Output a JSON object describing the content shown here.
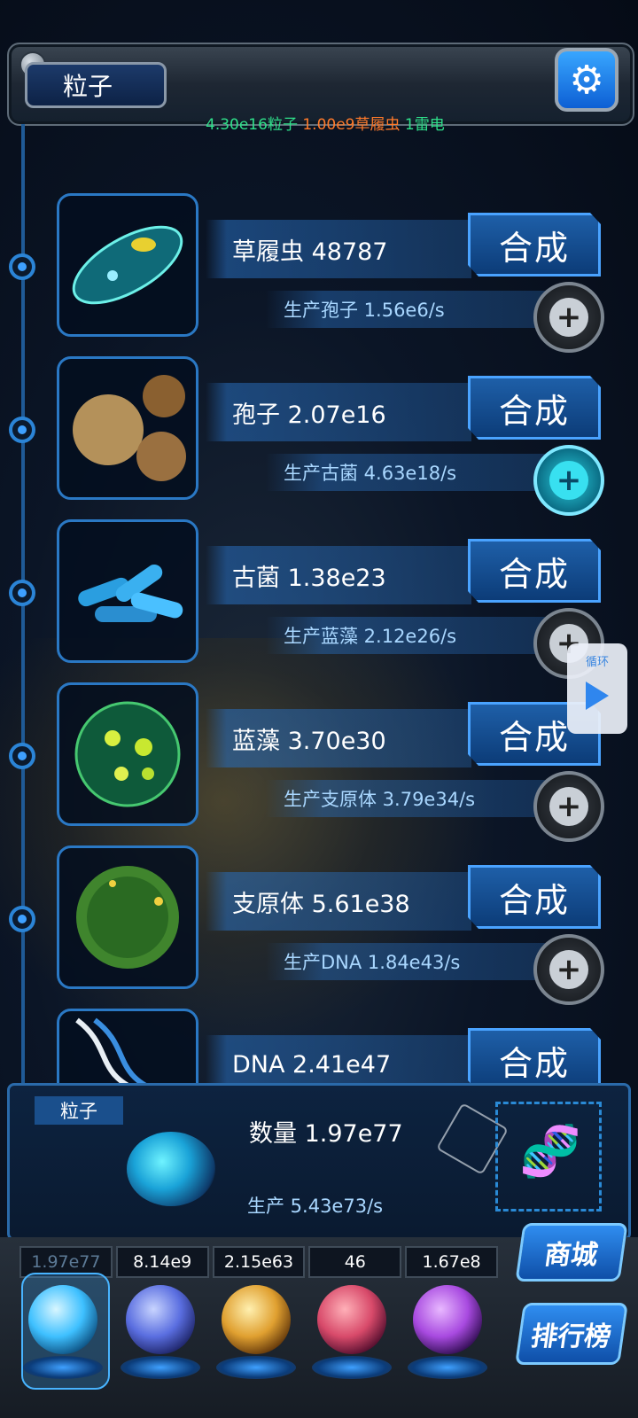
{
  "header": {
    "title": "粒子",
    "settings_icon": "gear-icon",
    "resources": {
      "particles": "4.30e16粒子",
      "paramecium": "1.00e9草履虫",
      "thunder": "1雷电"
    }
  },
  "rows": [
    {
      "name_count": "草履虫 48787",
      "production": "生产孢子 1.56e6/s",
      "merge_label": "合成",
      "thumb_icon": "paramecium-icon",
      "plus_active": false
    },
    {
      "name_count": "孢子 2.07e16",
      "production": "生产古菌 4.63e18/s",
      "merge_label": "合成",
      "thumb_icon": "spore-icon",
      "plus_active": true
    },
    {
      "name_count": "古菌 1.38e23",
      "production": "生产蓝藻 2.12e26/s",
      "merge_label": "合成",
      "thumb_icon": "archaea-icon",
      "plus_active": false
    },
    {
      "name_count": "蓝藻 3.70e30",
      "production": "生产支原体 3.79e34/s",
      "merge_label": "合成",
      "thumb_icon": "cyanobacteria-icon",
      "plus_active": false
    },
    {
      "name_count": "支原体 5.61e38",
      "production": "生产DNA 1.84e43/s",
      "merge_label": "合成",
      "thumb_icon": "mycoplasma-icon",
      "plus_active": false
    },
    {
      "name_count": "DNA 2.41e47",
      "production": "",
      "merge_label": "合成",
      "thumb_icon": "dna-icon",
      "plus_active": false
    }
  ],
  "loop": {
    "label": "循环",
    "icon": "play-icon"
  },
  "summary": {
    "tag": "粒子",
    "count": "数量 1.97e77",
    "production": "生产 5.43e73/s"
  },
  "bottom_tabs": {
    "values": [
      "1.97e77",
      "8.14e9",
      "2.15e63",
      "46",
      "1.67e8"
    ],
    "orbs": [
      {
        "icon": "particle-orb-icon",
        "color": "#49c8ff",
        "selected": true
      },
      {
        "icon": "thunder-orb-icon",
        "color": "#6f8cff",
        "selected": false
      },
      {
        "icon": "galaxy-orb-icon",
        "color": "#e0a030",
        "selected": false
      },
      {
        "icon": "brain-orb-icon",
        "color": "#d84a6a",
        "selected": false
      },
      {
        "icon": "vortex-orb-icon",
        "color": "#a84ae0",
        "selected": false
      }
    ]
  },
  "side_buttons": {
    "shop": "商城",
    "rank": "排行榜"
  }
}
